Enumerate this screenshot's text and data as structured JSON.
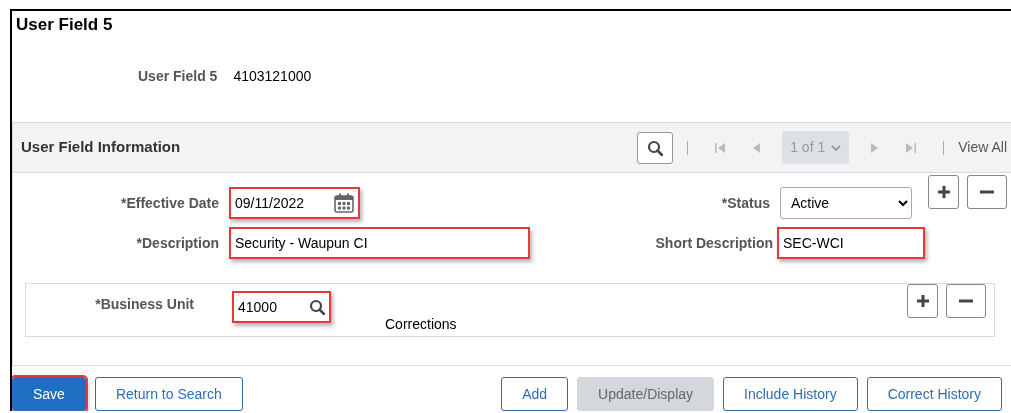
{
  "page": {
    "title": "User Field 5"
  },
  "key_field": {
    "label": "User Field 5",
    "value": "4103121000"
  },
  "section": {
    "title": "User Field Information",
    "nav": {
      "counter": "1 of 1",
      "view_all": "View All"
    },
    "effective_date": {
      "label": "*Effective Date",
      "value": "09/11/2022",
      "highlighted": true
    },
    "status": {
      "label": "*Status",
      "value": "Active"
    },
    "description": {
      "label": "*Description",
      "value": "Security - Waupun CI",
      "highlighted": true
    },
    "short_description": {
      "label": "Short Description",
      "value": "SEC-WCI",
      "highlighted": true
    },
    "business_unit": {
      "label": "*Business Unit",
      "value": "41000",
      "highlighted": true,
      "name": "Corrections"
    }
  },
  "buttons_left": [
    {
      "label": "Save",
      "kind": "primary",
      "highlighted": true,
      "disabled": false
    },
    {
      "label": "Return to Search",
      "kind": "secondary",
      "highlighted": false,
      "disabled": false
    }
  ],
  "buttons_right": [
    {
      "label": "Add",
      "kind": "secondary",
      "highlighted": false,
      "disabled": false
    },
    {
      "label": "Update/Display",
      "kind": "secondary",
      "highlighted": false,
      "disabled": true
    },
    {
      "label": "Include History",
      "kind": "secondary",
      "highlighted": false,
      "disabled": false
    },
    {
      "label": "Correct History",
      "kind": "secondary",
      "highlighted": false,
      "disabled": false
    }
  ]
}
